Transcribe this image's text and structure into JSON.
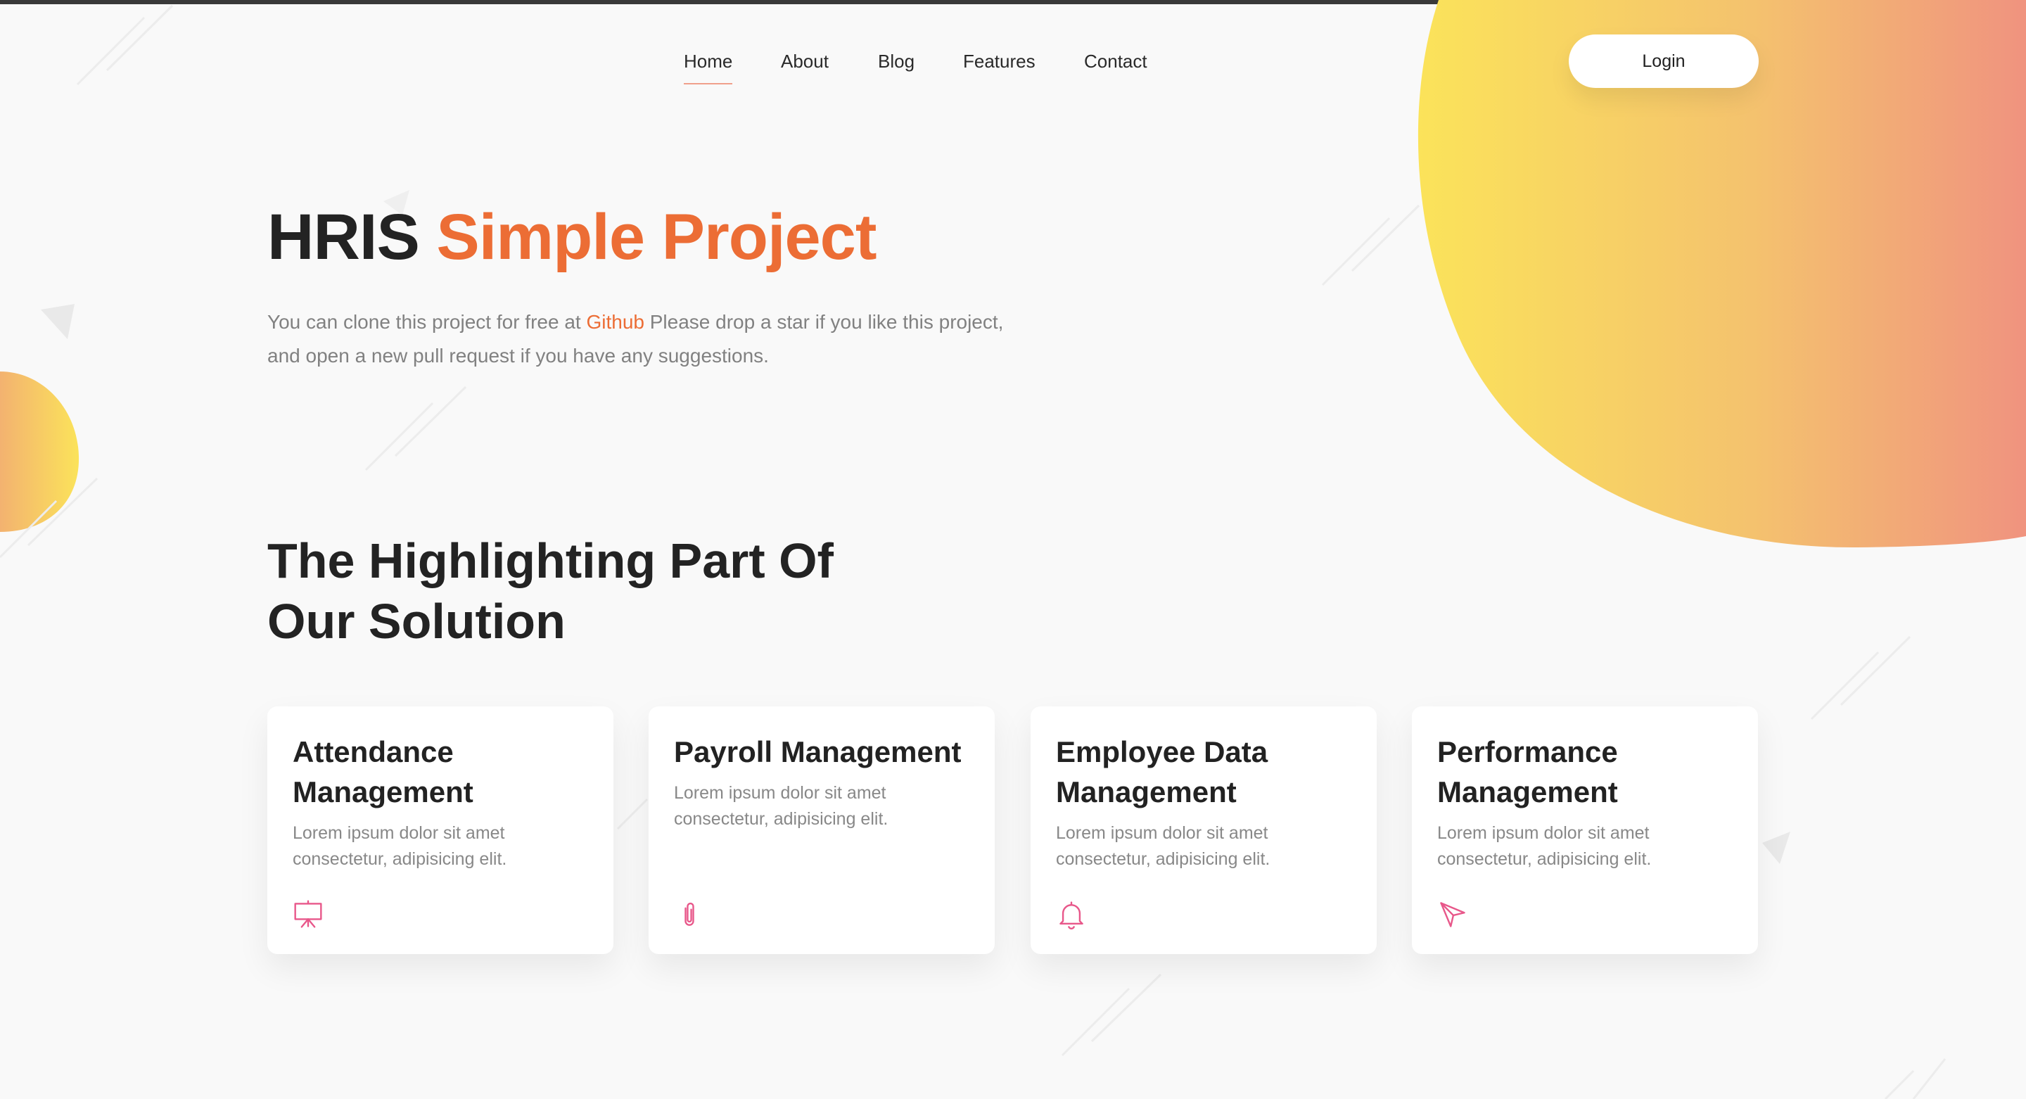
{
  "nav": {
    "items": [
      {
        "label": "Home",
        "active": true
      },
      {
        "label": "About"
      },
      {
        "label": "Blog"
      },
      {
        "label": "Features"
      },
      {
        "label": "Contact"
      }
    ],
    "login_label": "Login"
  },
  "hero": {
    "title_main": "HRIS",
    "title_accent": "Simple Project",
    "desc_before": "You can clone this project for free at",
    "desc_link": "Github",
    "desc_after": "Please drop a star if you like this project, and open a new pull request if you have any suggestions."
  },
  "features": {
    "title": "The Highlighting Part Of Our Solution",
    "cards": [
      {
        "title": "Attendance Management",
        "desc": "Lorem ipsum dolor sit amet consectetur, adipisicing elit.",
        "icon": "presentation-board-icon"
      },
      {
        "title": "Payroll Management",
        "desc": "Lorem ipsum dolor sit amet consectetur, adipisicing elit.",
        "icon": "paperclip-icon"
      },
      {
        "title": "Employee Data Management",
        "desc": "Lorem ipsum dolor sit amet consectetur, adipisicing elit.",
        "icon": "bell-icon"
      },
      {
        "title": "Performance Management",
        "desc": "Lorem ipsum dolor sit amet consectetur, adipisicing elit.",
        "icon": "send-arrow-icon"
      }
    ]
  },
  "colors": {
    "accent": "#ec6d35",
    "icon": "#e8578a",
    "blob_start": "#fbe35a",
    "blob_end": "#f0937f",
    "background": "#f9f9f9"
  }
}
